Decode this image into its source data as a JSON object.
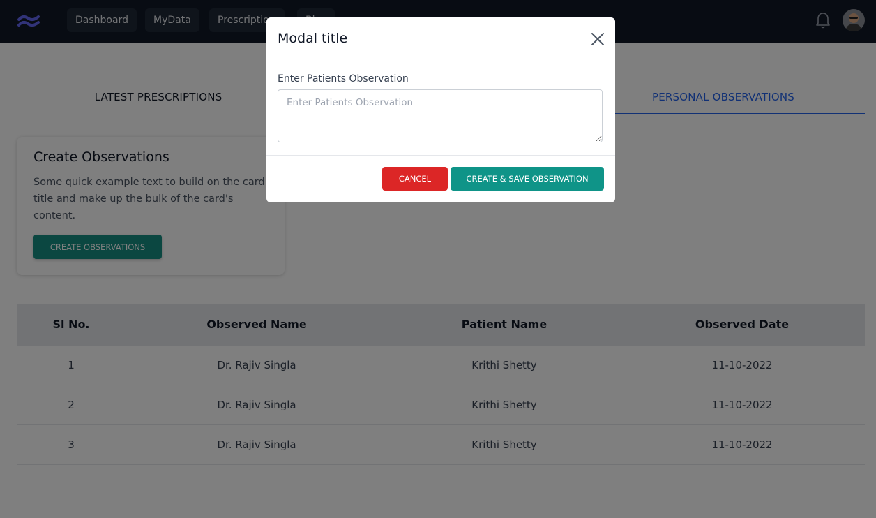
{
  "nav": {
    "items": [
      {
        "label": "Dashboard"
      },
      {
        "label": "MyData"
      },
      {
        "label": "Prescriptions"
      },
      {
        "label": "Blog"
      }
    ]
  },
  "tabs": {
    "latest": "LATEST PRESCRIPTIONS",
    "personal": "PERSONAL OBSERVATIONS"
  },
  "card": {
    "title": "Create Observations",
    "text": "Some quick example text to build on the card title and make up the bulk of the card's content.",
    "button": "CREATE OBSERVATIONS"
  },
  "table": {
    "headers": [
      "Sl No.",
      "Observed Name",
      "Patient Name",
      "Observed Date"
    ],
    "rows": [
      [
        "1",
        "Dr. Rajiv Singla",
        "Krithi Shetty",
        "11-10-2022"
      ],
      [
        "2",
        "Dr. Rajiv Singla",
        "Krithi Shetty",
        "11-10-2022"
      ],
      [
        "3",
        "Dr. Rajiv Singla",
        "Krithi Shetty",
        "11-10-2022"
      ]
    ]
  },
  "modal": {
    "title": "Modal title",
    "field_label": "Enter Patients Observation",
    "field_placeholder": "Enter Patients Observation",
    "field_value": "",
    "cancel": "CANCEL",
    "save": "CREATE & SAVE OBSERVATION"
  },
  "colors": {
    "nav_bg": "#111827",
    "active_tab": "#2563eb",
    "teal_button": "#0f9488",
    "cancel_button": "#dc2626"
  },
  "icons": {
    "logo": "logo-icon",
    "notifications": "bell-icon",
    "close": "close-icon"
  }
}
